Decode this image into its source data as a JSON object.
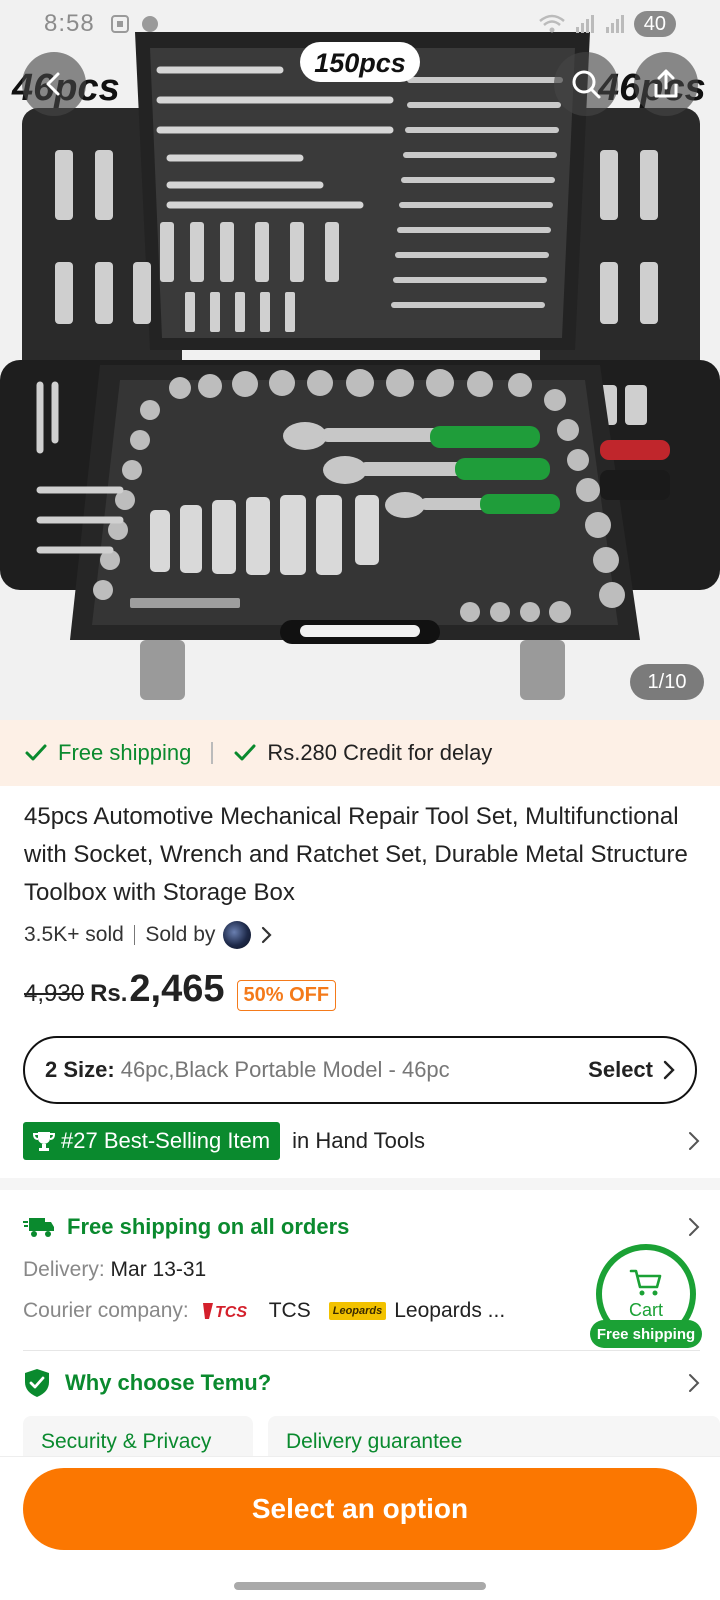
{
  "status_bar": {
    "time": "8:58",
    "battery": "40"
  },
  "hero": {
    "overlay_left": "46pcs",
    "overlay_right": "46pcs",
    "case_label": "150pcs",
    "counter": "1/10"
  },
  "shipping_banner": {
    "free_shipping": "Free shipping",
    "credit": "Rs.280 Credit for delay"
  },
  "product": {
    "title": "45pcs Automotive Mechanical Repair Tool Set, Multifunctional with Socket, Wrench and Ratchet Set, Durable Metal Structure Toolbox with Storage Box",
    "sold": "3.5K+ sold",
    "sold_by": "Sold by"
  },
  "price": {
    "old": "4,930",
    "currency": "Rs.",
    "current": "2,465",
    "discount": "50% OFF"
  },
  "size": {
    "label": "2 Size:",
    "value": "46pc,Black Portable Model - 46pc",
    "action": "Select"
  },
  "best_seller": {
    "badge": "#27 Best-Selling Item",
    "category": "in Hand Tools"
  },
  "shipping_info": {
    "heading": "Free shipping on all orders",
    "delivery_label": "Delivery:",
    "delivery_value": "Mar 13-31",
    "courier_label": "Courier company:",
    "courier_1_logo": "TCS",
    "courier_1": "TCS",
    "courier_2_logo": "Leopards",
    "courier_2": "Leopards ..."
  },
  "cart_float": {
    "label": "Cart",
    "badge": "Free shipping"
  },
  "why": {
    "heading": "Why choose Temu?",
    "cards": [
      "Security & Privacy",
      "Delivery guarantee"
    ]
  },
  "cta": {
    "label": "Select an option"
  },
  "colors": {
    "accent_orange": "#fb7701",
    "green": "#0a8a2e",
    "cart_green": "#1ba135",
    "banner_bg": "#fdf0e6"
  },
  "icons": [
    "back-arrow-icon",
    "search-icon",
    "share-icon",
    "check-icon",
    "chevron-right-icon",
    "trophy-icon",
    "truck-icon",
    "shield-check-icon",
    "cart-icon"
  ]
}
